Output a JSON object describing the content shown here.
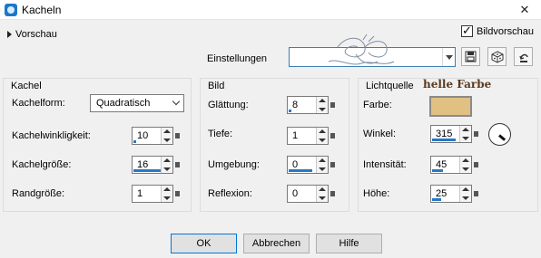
{
  "window": {
    "title": "Kacheln",
    "close": "✕"
  },
  "preview": {
    "toggle_label": "Vorschau",
    "checkbox_label": "Bildvorschau",
    "checked": true
  },
  "settings": {
    "label": "Einstellungen",
    "value": ""
  },
  "kachel": {
    "title": "Kachel",
    "form_label": "Kachelform:",
    "form_value": "Quadratisch",
    "angle_label": "Kachelwinkligkeit:",
    "angle_value": "10",
    "size_label": "Kachelgröße:",
    "size_value": "16",
    "border_label": "Randgröße:",
    "border_value": "1"
  },
  "bild": {
    "title": "Bild",
    "smooth_label": "Glättung:",
    "smooth_value": "8",
    "depth_label": "Tiefe:",
    "depth_value": "1",
    "ambient_label": "Umgebung:",
    "ambient_value": "0",
    "reflect_label": "Reflexion:",
    "reflect_value": "0"
  },
  "licht": {
    "title": "Lichtquelle",
    "color_label": "Farbe:",
    "color_value": "#e0c183",
    "color_note": "helle Farbe",
    "angle_label": "Winkel:",
    "angle_value": "315",
    "intensity_label": "Intensität:",
    "intensity_value": "45",
    "height_label": "Höhe:",
    "height_value": "25"
  },
  "buttons": {
    "ok": "OK",
    "cancel": "Abbrechen",
    "help": "Hilfe"
  }
}
